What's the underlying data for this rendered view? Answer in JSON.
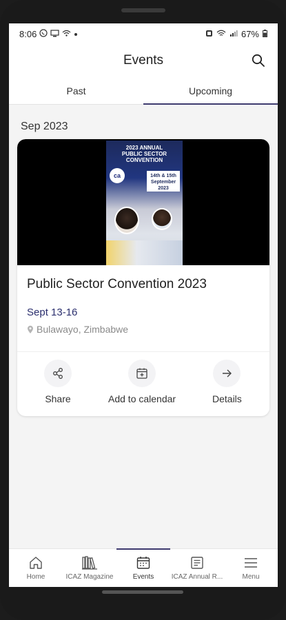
{
  "status_bar": {
    "time": "8:06",
    "battery": "67%"
  },
  "header": {
    "title": "Events"
  },
  "tabs": [
    {
      "label": "Past",
      "active": false
    },
    {
      "label": "Upcoming",
      "active": true
    }
  ],
  "month_heading": "Sep 2023",
  "event": {
    "title": "Public Sector Convention 2023",
    "date": "Sept 13-16",
    "location": "Bulawayo, Zimbabwe",
    "poster": {
      "title_line1": "2023 ANNUAL",
      "title_line2": "PUBLIC SECTOR",
      "title_line3": "CONVENTION",
      "logo": "ca",
      "date_text": "14th & 15th September 2023"
    },
    "actions": [
      {
        "label": "Share",
        "icon": "share-icon"
      },
      {
        "label": "Add to calendar",
        "icon": "calendar-add-icon"
      },
      {
        "label": "Details",
        "icon": "arrow-right-icon"
      }
    ]
  },
  "bottom_nav": [
    {
      "label": "Home",
      "icon": "home-icon",
      "active": false
    },
    {
      "label": "ICAZ Magazine",
      "icon": "books-icon",
      "active": false
    },
    {
      "label": "Events",
      "icon": "calendar-icon",
      "active": true
    },
    {
      "label": "ICAZ Annual R...",
      "icon": "report-icon",
      "active": false
    },
    {
      "label": "Menu",
      "icon": "menu-icon",
      "active": false
    }
  ],
  "colors": {
    "accent": "#3d3a6e",
    "date_text": "#2b2f6e",
    "background": "#f4f4f4"
  }
}
